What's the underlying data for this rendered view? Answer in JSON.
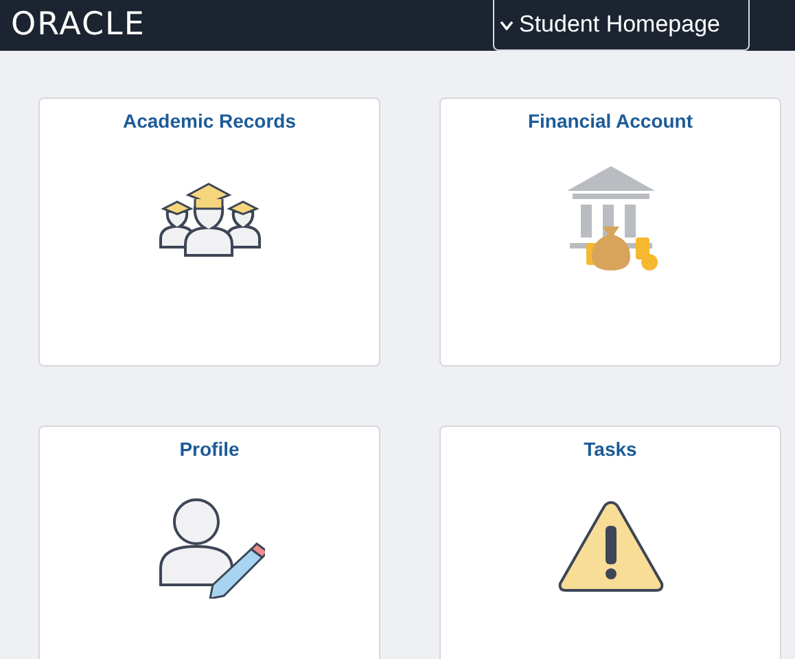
{
  "header": {
    "logo": "ORACLE",
    "homepage_menu": {
      "label": "Student Homepage",
      "expanded": false
    }
  },
  "tiles": [
    {
      "title": "Academic Records",
      "kind": "graduates"
    },
    {
      "title": "Financial Account",
      "kind": "bank"
    },
    {
      "title": "Profile",
      "kind": "profile"
    },
    {
      "title": "Tasks",
      "kind": "warning"
    }
  ]
}
